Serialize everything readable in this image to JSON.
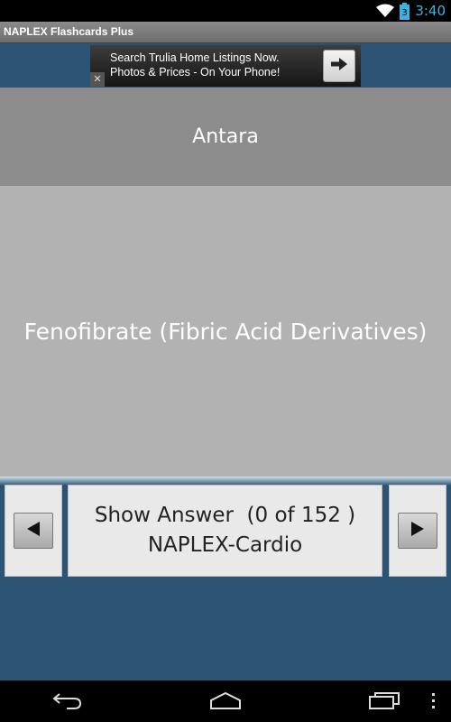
{
  "status_bar": {
    "time": "3:40",
    "battery_level": "3",
    "icons": [
      "wifi-icon",
      "battery-charging-icon"
    ]
  },
  "app": {
    "title": "NAPLEX Flashcards Plus"
  },
  "ad": {
    "line1": "Search Trulia Home Listings Now.",
    "line2": "Photos & Prices - On Your Phone!",
    "close_label": "✕",
    "arrow_icon": "arrow-right-icon"
  },
  "card": {
    "question": "Antara",
    "answer": "Fenofibrate (Fibric Acid Derivatives)"
  },
  "controls": {
    "show_answer_label": "Show Answer  (0 of 152 )",
    "deck_name": "NAPLEX-Cardio",
    "prev_icon": "triangle-left-icon",
    "next_icon": "triangle-right-icon"
  },
  "nav_bar": {
    "icons": [
      "back-icon",
      "home-icon",
      "recent-apps-icon",
      "overflow-menu-icon"
    ]
  },
  "colors": {
    "background": "#2b5474",
    "question_panel": "#8c8c8c",
    "answer_panel": "#b2b2b2",
    "status_time": "#33b5e5"
  }
}
